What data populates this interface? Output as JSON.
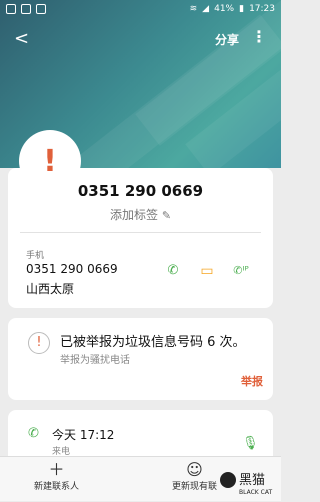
{
  "status_bar": {
    "battery": "41%",
    "time": "17:23"
  },
  "toolbar": {
    "back_icon": "back-arrow-icon",
    "share_label": "分享",
    "more_icon": "more-vertical-icon"
  },
  "contact": {
    "number_title": "0351 290 0669",
    "add_tag_label": "添加标签",
    "phone_type_label": "手机",
    "phone_number": "0351 290 0669",
    "location": "山西太原"
  },
  "spam": {
    "headline": "已被举报为垃圾信息号码 6 次。",
    "subtext": "举报为骚扰电话",
    "report_label": "举报"
  },
  "call_log": {
    "time": "今天 17:12",
    "type": "来电"
  },
  "bottom_bar": {
    "new_contact": "新建联系人",
    "update_contact": "更新现有联"
  },
  "watermark": {
    "text_cn": "黑猫",
    "text_en": "BLACK CAT"
  },
  "colors": {
    "accent_orange": "#e0603a",
    "green": "#4caf50",
    "header_teal": "#3c8a90"
  }
}
